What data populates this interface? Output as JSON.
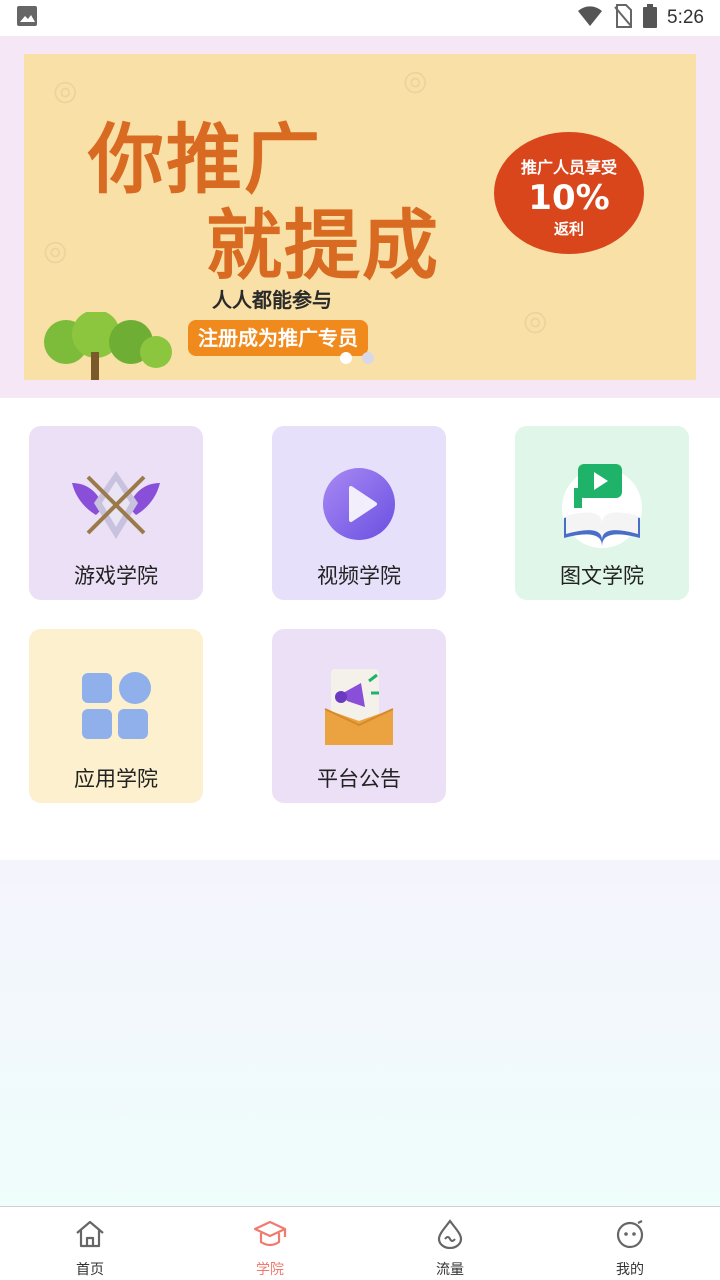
{
  "status_bar": {
    "time": "5:26",
    "icons": [
      "image-icon",
      "wifi-icon",
      "no-sim-icon",
      "battery-icon"
    ]
  },
  "banner": {
    "line1": "你推广",
    "line2": "就提成",
    "tagline": "人人都能参与",
    "cta": "注册成为推广专员",
    "badge_top": "推广人员享受",
    "badge_percent": "10%",
    "badge_bottom": "返利",
    "total_slides": 2,
    "active_slide": 1
  },
  "academies": [
    {
      "label": "游戏学院",
      "icon": "game-emblem-icon",
      "bg": "#ebe0f6"
    },
    {
      "label": "视频学院",
      "icon": "video-play-icon",
      "bg": "#e6e0fb"
    },
    {
      "label": "图文学院",
      "icon": "book-flag-icon",
      "bg": "#dff6e8"
    },
    {
      "label": "应用学院",
      "icon": "app-grid-icon",
      "bg": "#fdf0cf"
    },
    {
      "label": "平台公告",
      "icon": "megaphone-icon",
      "bg": "#ebe0f6"
    }
  ],
  "tabs": [
    {
      "label": "首页",
      "icon": "home-icon",
      "active": false
    },
    {
      "label": "学院",
      "icon": "graduation-cap-icon",
      "active": true
    },
    {
      "label": "流量",
      "icon": "droplet-icon",
      "active": false
    },
    {
      "label": "我的",
      "icon": "face-icon",
      "active": false
    }
  ],
  "colors": {
    "accent": "#ef7a6d",
    "banner_bg": "#f9e0a6",
    "banner_text": "#d86a22"
  }
}
